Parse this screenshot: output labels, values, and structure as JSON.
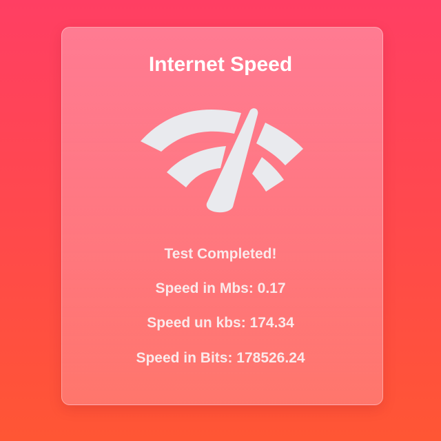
{
  "title": "Internet Speed",
  "status": "Test Completed!",
  "results": {
    "mbs": "Speed in Mbs: 0.17",
    "kbs": "Speed un kbs: 174.34",
    "bits": "Speed in Bits: 178526.24"
  },
  "icon": "speedometer-wifi-icon",
  "colors": {
    "background_top": "#ff3f63",
    "background_bottom": "#ff5634",
    "icon_fill": "#e9eaee",
    "text": "#ffffff"
  }
}
